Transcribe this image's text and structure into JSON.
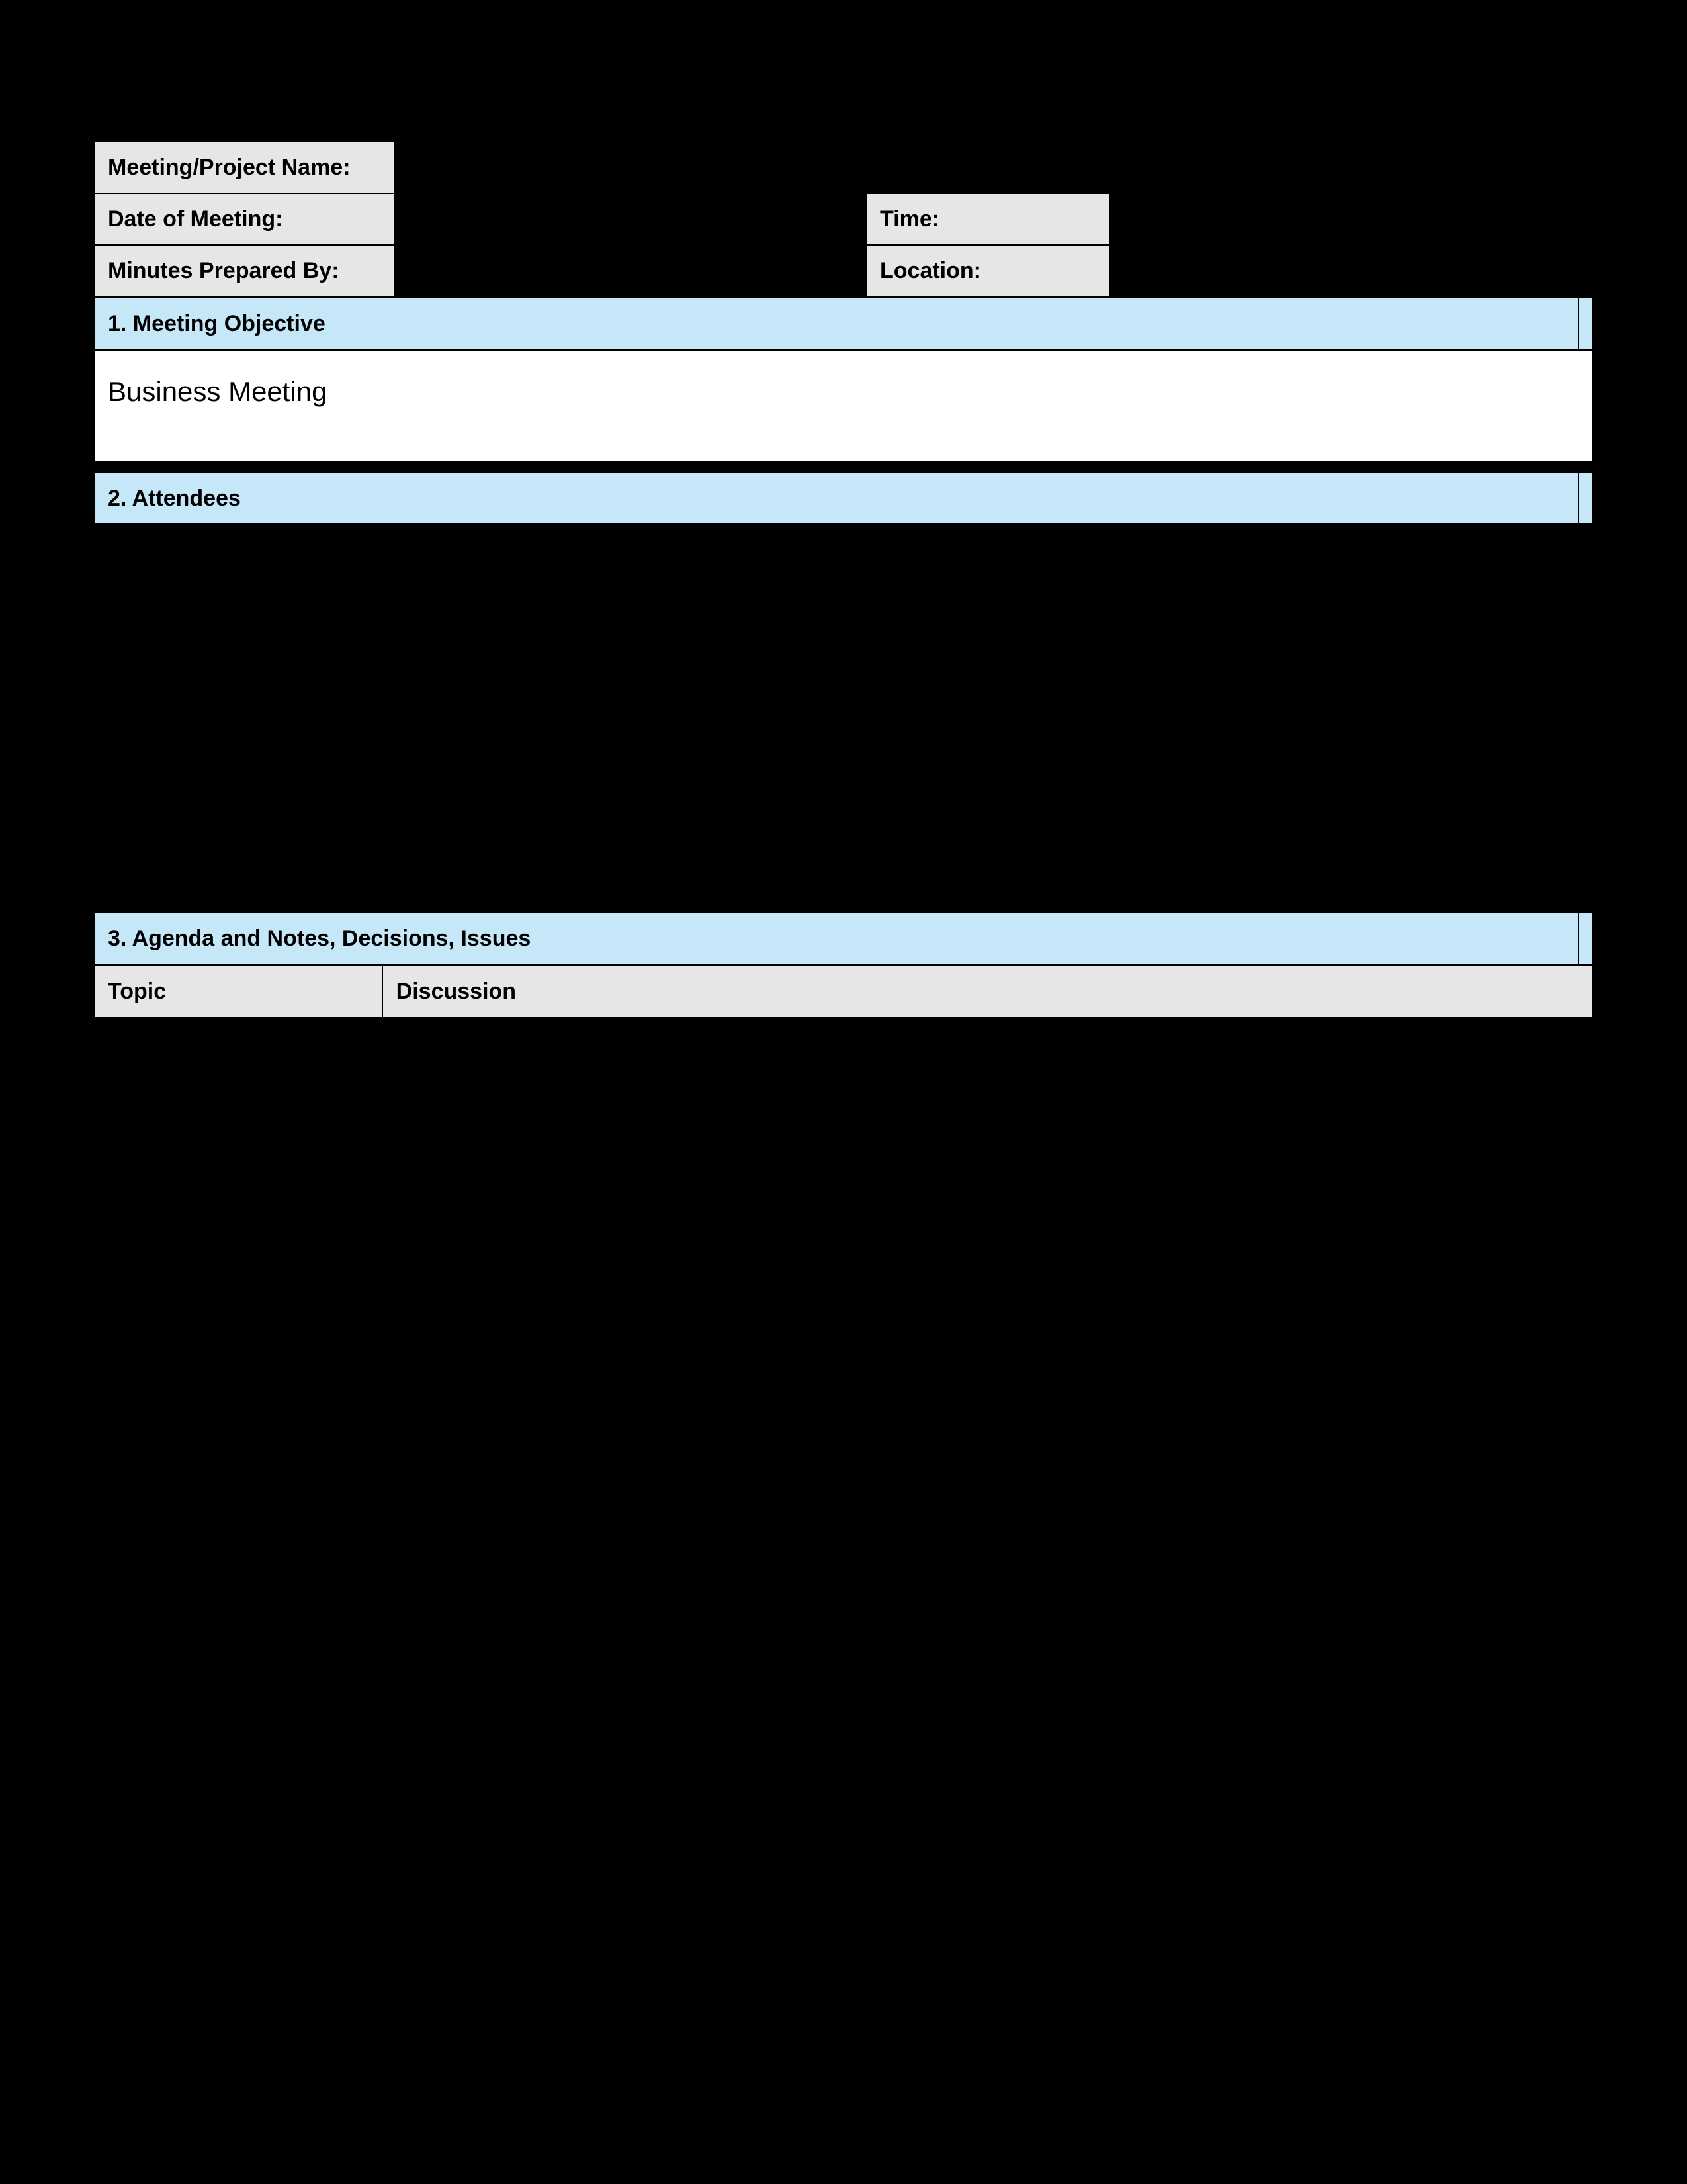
{
  "info": {
    "meeting_name_label": "Meeting/Project Name:",
    "meeting_name_value": "",
    "date_label": "Date of Meeting:",
    "date_value": "",
    "time_label": "Time:",
    "time_value": "",
    "prepared_by_label": "Minutes Prepared By:",
    "prepared_by_value": "",
    "location_label": "Location:",
    "location_value": ""
  },
  "sections": {
    "objective_header": "1. Meeting Objective",
    "objective_text": "Business Meeting",
    "attendees_header": "2. Attendees",
    "agenda_header": "3. Agenda and Notes, Decisions, Issues",
    "agenda_columns": {
      "topic": "Topic",
      "discussion": "Discussion"
    }
  }
}
